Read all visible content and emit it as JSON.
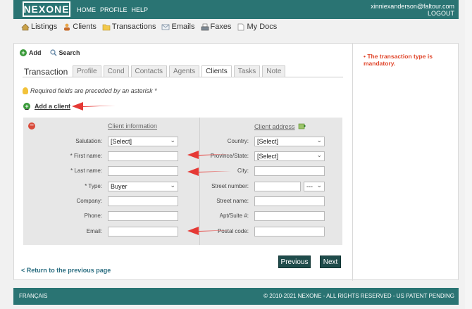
{
  "header": {
    "logo": "NEXONE",
    "nav": [
      "HOME",
      "PROFILE",
      "HELP"
    ],
    "user_email": "xinniexanderson@faltour.com",
    "logout": "LOGOUT"
  },
  "mainnav": [
    {
      "label": "Listings",
      "icon": "house-icon"
    },
    {
      "label": "Clients",
      "icon": "clients-icon"
    },
    {
      "label": "Transactions",
      "icon": "folder-icon"
    },
    {
      "label": "Emails",
      "icon": "envelope-icon"
    },
    {
      "label": "Faxes",
      "icon": "fax-icon"
    },
    {
      "label": "My Docs",
      "icon": "document-icon"
    }
  ],
  "toolbar": {
    "add": "Add",
    "search": "Search"
  },
  "tabs": [
    "Transaction",
    "Profile",
    "Cond",
    "Contacts",
    "Agents",
    "Clients",
    "Tasks",
    "Note"
  ],
  "active_tab": "Clients",
  "required_note": "Required fields are preceded by an asterisk *",
  "add_client": "Add a client",
  "client_info": {
    "heading": "Client information",
    "salutation_label": "Salutation:",
    "salutation_value": "[Select]",
    "first_name_label": "* First name:",
    "last_name_label": "* Last name:",
    "type_label": "* Type:",
    "type_value": "Buyer",
    "company_label": "Company:",
    "phone_label": "Phone:",
    "email_label": "Email:"
  },
  "client_address": {
    "heading": "Client address",
    "country_label": "Country:",
    "country_value": "[Select]",
    "province_label": "Province/State:",
    "province_value": "[Select]",
    "city_label": "City:",
    "street_number_label": "Street number:",
    "street_suffix_value": "---",
    "street_name_label": "Street name:",
    "apt_label": "Apt/Suite #:",
    "postal_label": "Postal code:"
  },
  "buttons": {
    "previous": "Previous",
    "next": "Next"
  },
  "back_link": "< Return to the previous page",
  "error": "The transaction type is mandatory.",
  "footer": {
    "language": "FRANÇAIS",
    "copyright": "© 2010-2021 NEXONE - ALL RIGHTS RESERVED - US PATENT PENDING"
  },
  "colors": {
    "brand": "#2a7473",
    "error": "#e0452a",
    "arrow": "#e53935",
    "button": "#1f4c4b"
  }
}
